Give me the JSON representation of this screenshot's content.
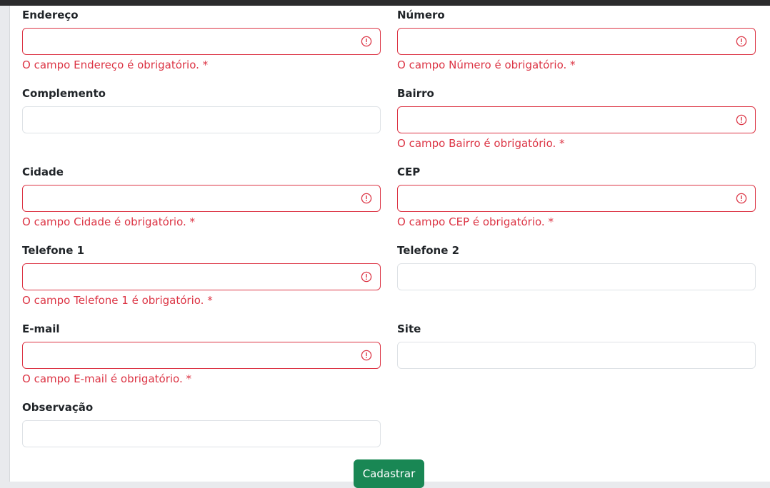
{
  "form": {
    "endereco": {
      "label": "Endereço",
      "value": "",
      "error": "O campo Endereço é obrigatório. *"
    },
    "numero": {
      "label": "Número",
      "value": "",
      "error": "O campo Número é obrigatório. *"
    },
    "complemento": {
      "label": "Complemento",
      "value": ""
    },
    "bairro": {
      "label": "Bairro",
      "value": "",
      "error": "O campo Bairro é obrigatório. *"
    },
    "cidade": {
      "label": "Cidade",
      "value": "",
      "error": "O campo Cidade é obrigatório. *"
    },
    "cep": {
      "label": "CEP",
      "value": "",
      "error": "O campo CEP é obrigatório. *"
    },
    "telefone1": {
      "label": "Telefone 1",
      "value": "",
      "error": "O campo Telefone 1 é obrigatório. *"
    },
    "telefone2": {
      "label": "Telefone 2",
      "value": ""
    },
    "email": {
      "label": "E-mail",
      "value": "",
      "error": "O campo E-mail é obrigatório. *"
    },
    "site": {
      "label": "Site",
      "value": ""
    },
    "observacao": {
      "label": "Observação",
      "value": ""
    },
    "submit_label": "Cadastrar"
  },
  "colors": {
    "error": "#dc3545",
    "success_button": "#198754",
    "input_border": "#dee2e6"
  },
  "icons": {
    "error": "exclamation-circle-icon"
  }
}
